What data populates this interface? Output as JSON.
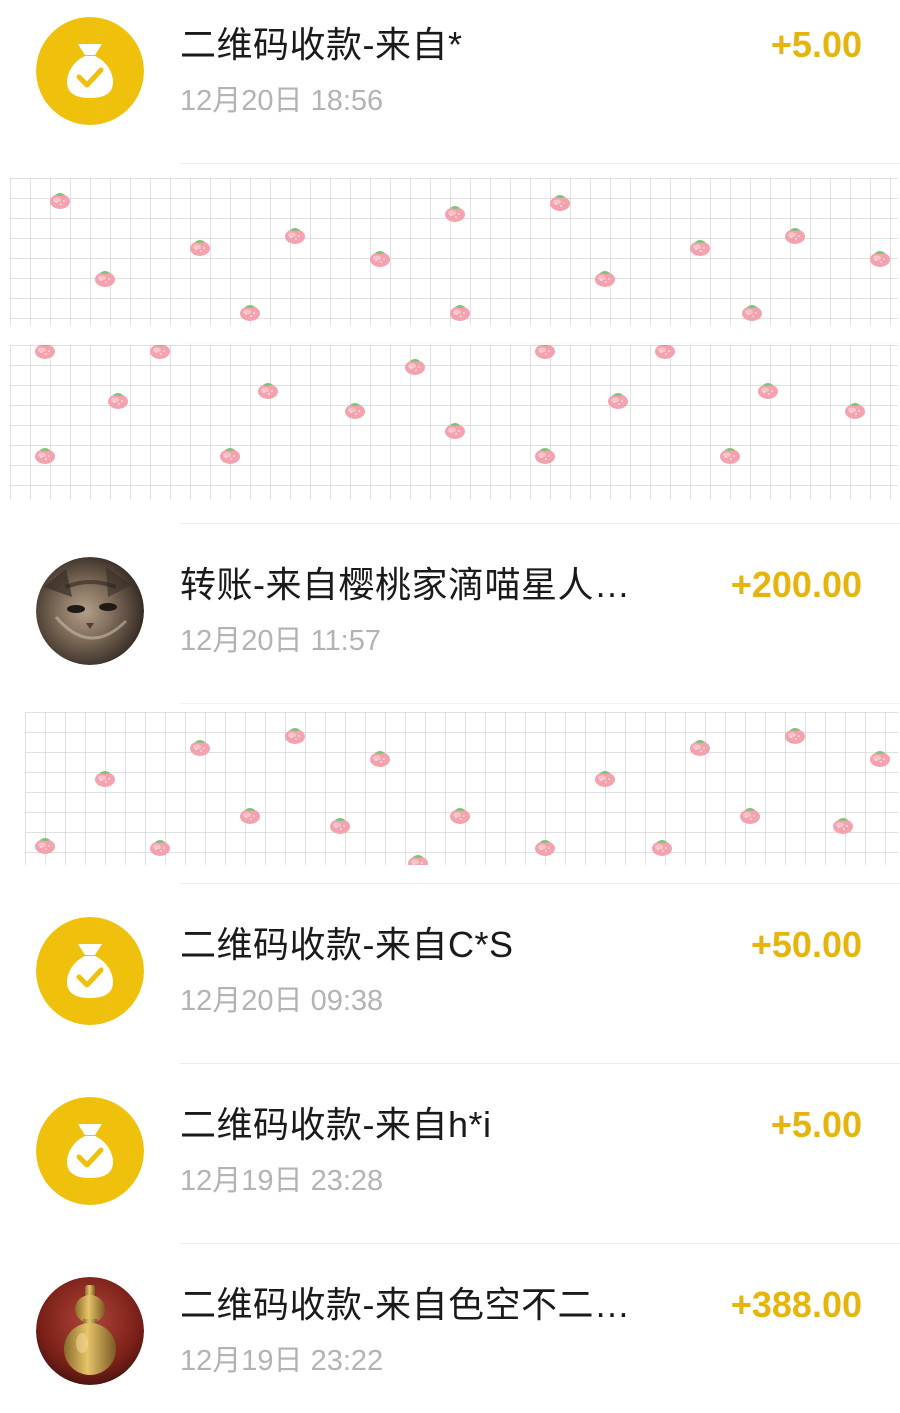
{
  "transactions": [
    {
      "icon": "money-bag-icon",
      "title": "二维码收款-来自*",
      "date": "12月20日 18:56",
      "amount": "+5.00"
    },
    {
      "icon": "cat-avatar",
      "title": "转账-来自樱桃家滴喵星人…",
      "date": "12月20日 11:57",
      "amount": "+200.00"
    },
    {
      "icon": "money-bag-icon",
      "title": "二维码收款-来自C*S",
      "date": "12月20日 09:38",
      "amount": "+50.00"
    },
    {
      "icon": "money-bag-icon",
      "title": "二维码收款-来自h*i",
      "date": "12月19日 23:28",
      "amount": "+5.00"
    },
    {
      "icon": "gourd-avatar",
      "title": "二维码收款-来自色空不二…",
      "date": "12月19日 23:22",
      "amount": "+388.00"
    }
  ],
  "colors": {
    "amount": "#E5B50E",
    "icon_bg": "#EFC10D",
    "title": "#1A1A1A",
    "date": "#B3B3B3",
    "separator": "#ECECEC",
    "sticker_strawberry": "#F4A3AE",
    "sticker_leaf": "#7CC57A"
  }
}
